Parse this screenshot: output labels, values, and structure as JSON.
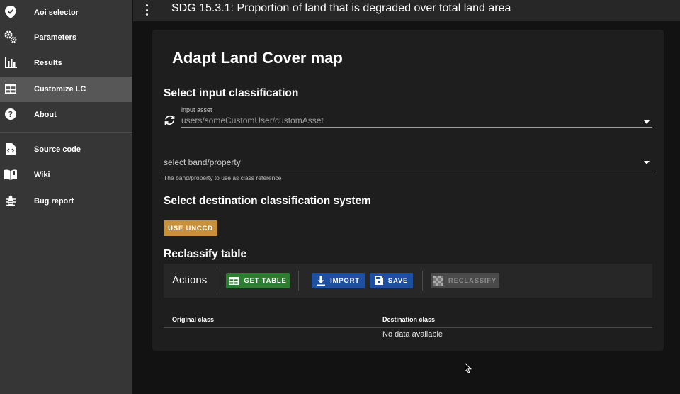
{
  "sidebar": {
    "items": [
      {
        "label": "Aoi selector",
        "icon": "map-marker-check-icon"
      },
      {
        "label": "Parameters",
        "icon": "cogs-icon"
      },
      {
        "label": "Results",
        "icon": "bar-chart-icon"
      },
      {
        "label": "Customize LC",
        "icon": "table-icon",
        "active": true
      },
      {
        "label": "About",
        "icon": "help-circle-icon"
      }
    ],
    "links": [
      {
        "label": "Source code",
        "icon": "code-file-icon"
      },
      {
        "label": "Wiki",
        "icon": "book-icon"
      },
      {
        "label": "Bug report",
        "icon": "bug-icon"
      }
    ]
  },
  "header": {
    "title": "SDG 15.3.1: Proportion of land that is degraded over total land area"
  },
  "main": {
    "title": "Adapt Land Cover map",
    "input_section": {
      "title": "Select input classification",
      "asset_label": "input asset",
      "asset_value": "users/someCustomUser/customAsset",
      "band_placeholder": "select band/property",
      "band_hint": "The band/property to use as class reference"
    },
    "destination_section": {
      "title": "Select destination classification system",
      "unccd_button": "USE UNCCD"
    },
    "reclassify_section": {
      "title": "Reclassify table",
      "actions_label": "Actions",
      "get_table_button": "GET TABLE",
      "import_button": "IMPORT",
      "save_button": "SAVE",
      "reclassify_button": "RECLASSIFY",
      "columns": [
        "Original class",
        "Destination class"
      ],
      "empty_text": "No data available"
    }
  },
  "colors": {
    "sidebar_bg": "#363636",
    "active_item_bg": "#575757",
    "unccd_button": "#c6913a",
    "get_table_button": "#2e7d32",
    "primary_button": "#1f4fa0",
    "disabled_button": "#4a4a4a"
  }
}
